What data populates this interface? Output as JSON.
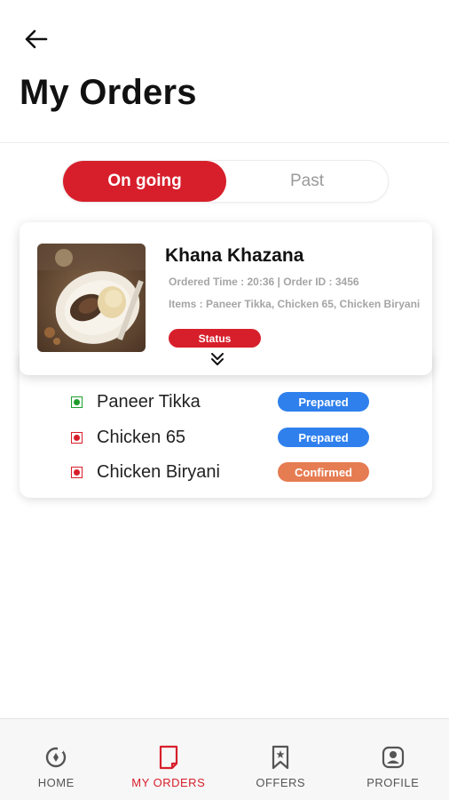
{
  "header": {
    "back_icon": "arrow-left-icon",
    "title": "My Orders"
  },
  "tabs": {
    "ongoing": "On going",
    "past": "Past",
    "selected": "On going"
  },
  "order": {
    "restaurant": "Khana Khazana",
    "ordered_time_line": "Ordered Time : 20:36  | Order ID : 3456",
    "items_line": "Items : Paneer Tikka, Chicken 65, Chicken Biryani",
    "status_label": "Status",
    "expand_icon": "double-chevron-down-icon",
    "items": [
      {
        "name": "Paneer Tikka",
        "veg": true,
        "status": "Prepared",
        "status_color": "#2f80ed"
      },
      {
        "name": "Chicken 65",
        "veg": false,
        "status": "Prepared",
        "status_color": "#2f80ed"
      },
      {
        "name": "Chicken Biryani",
        "veg": false,
        "status": "Confirmed",
        "status_color": "#e67c52"
      }
    ]
  },
  "nav": {
    "items": [
      {
        "label": "HOME",
        "icon": "home-icon"
      },
      {
        "label": "MY ORDERS",
        "icon": "orders-icon"
      },
      {
        "label": "OFFERS",
        "icon": "bookmark-icon"
      },
      {
        "label": "PROFILE",
        "icon": "profile-icon"
      }
    ],
    "active": "MY ORDERS"
  },
  "colors": {
    "accent": "#d71f2b",
    "veg": "#1f9d2e",
    "non_veg": "#d71f2b",
    "prepared": "#2f80ed",
    "confirmed": "#e67c52"
  }
}
